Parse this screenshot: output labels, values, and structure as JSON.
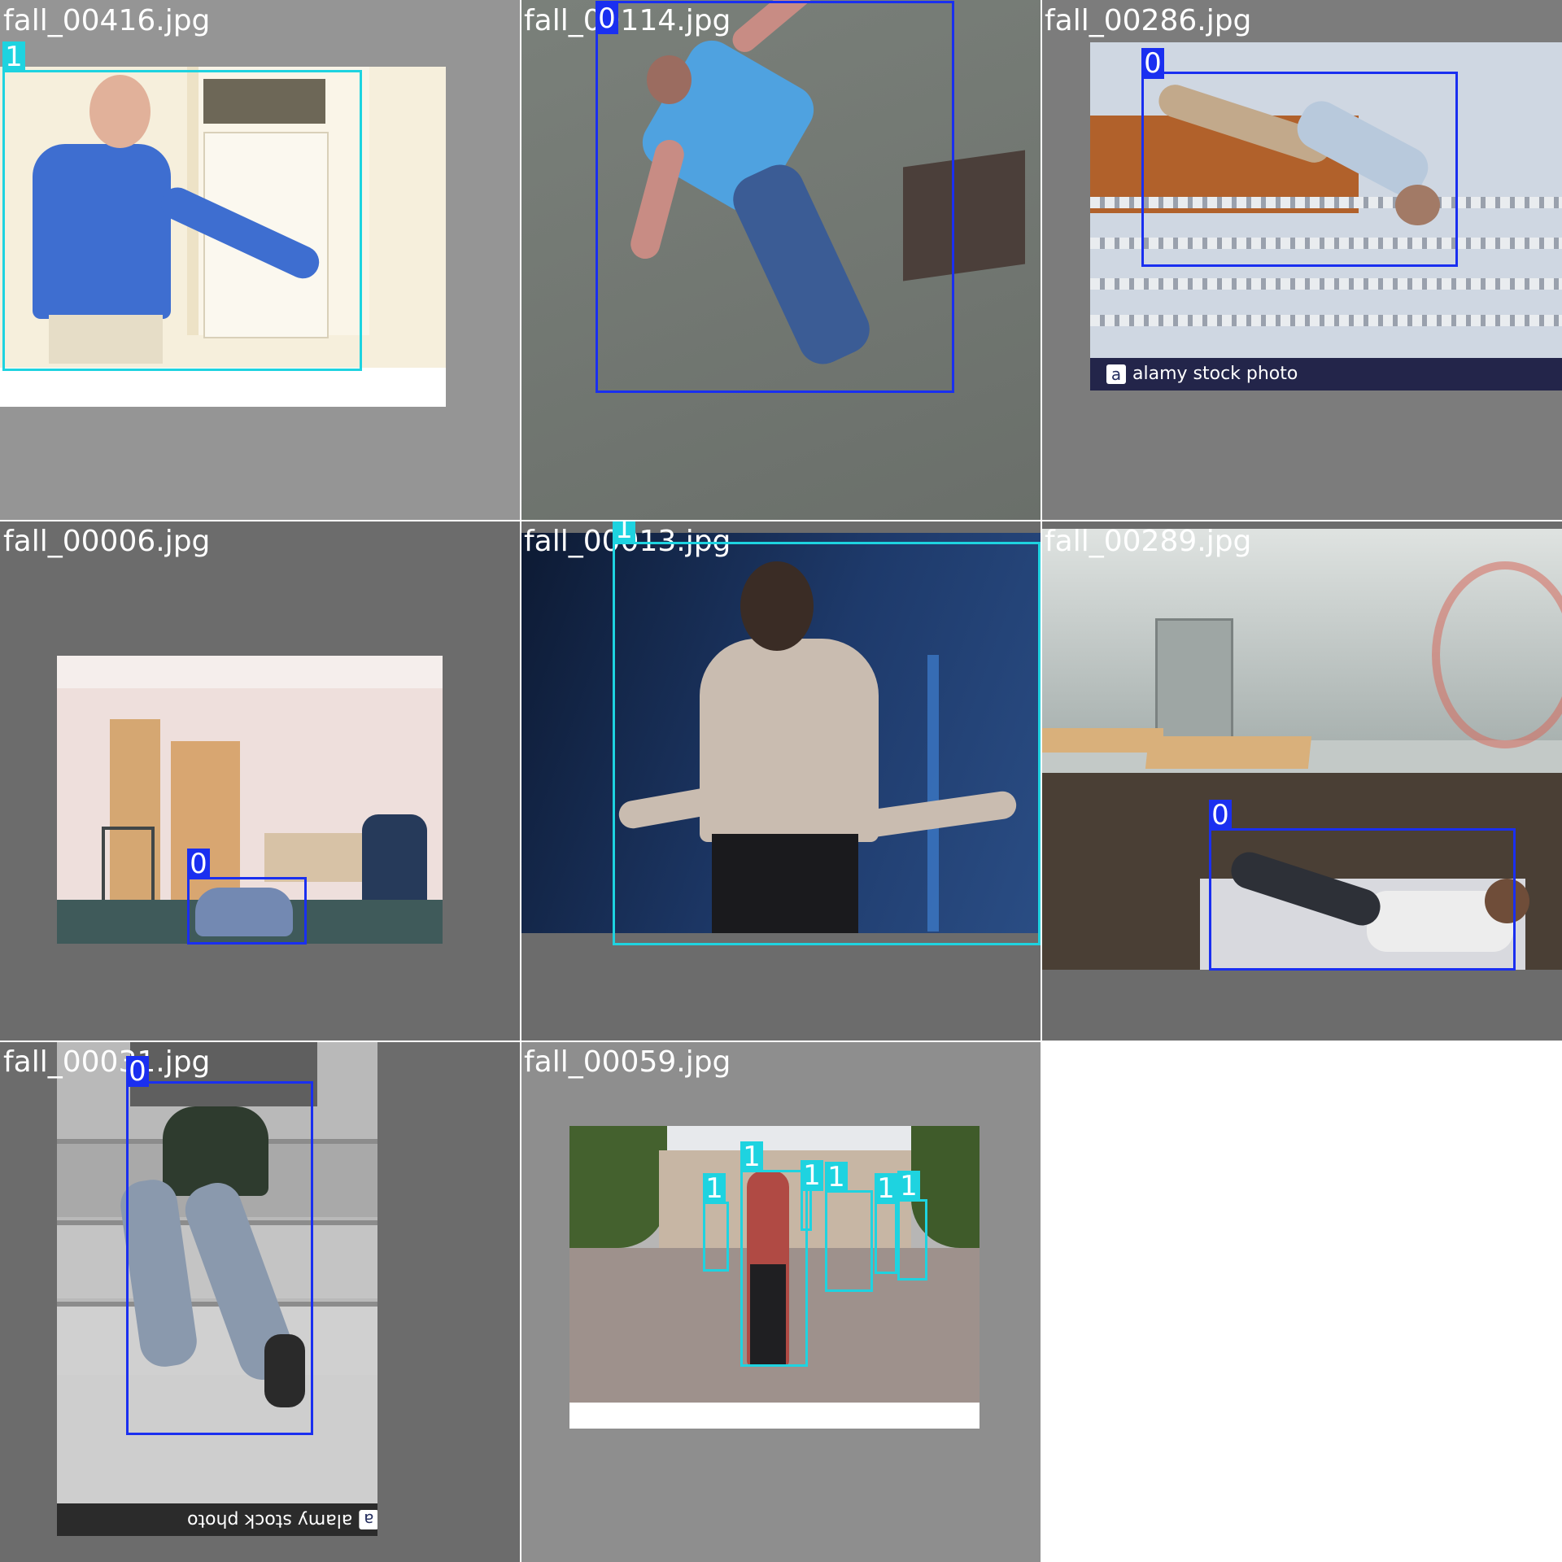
{
  "tiles": [
    {
      "filename": "fall_00416.jpg",
      "scene": "Elderly man in blue shirt smiling and gesturing in front of a white doorway",
      "boxes": [
        {
          "class": 1,
          "label": "1"
        }
      ]
    },
    {
      "filename": "fall_00114.jpg",
      "scene": "Overhead view of a man in a blue t-shirt and jeans lying on a grey floor",
      "boxes": [
        {
          "class": 0,
          "label": "0"
        }
      ]
    },
    {
      "filename": "fall_00286.jpg",
      "scene": "Man fallen on stairs",
      "watermark": "alamy stock photo",
      "boxes": [
        {
          "class": 0,
          "label": "0"
        }
      ]
    },
    {
      "filename": "fall_00006.jpg",
      "scene": "Office room with a person collapsed on the floor",
      "boxes": [
        {
          "class": 0,
          "label": "0"
        }
      ]
    },
    {
      "filename": "fall_00013.jpg",
      "scene": "Woman in white top standing with arms out against a dark blue background",
      "boxes": [
        {
          "class": 1,
          "label": "1"
        }
      ]
    },
    {
      "filename": "fall_00289.jpg",
      "scene": "Man lying on the floor of a lobby with glass walls",
      "boxes": [
        {
          "class": 0,
          "label": "0"
        }
      ]
    },
    {
      "filename": "fall_00031.jpg",
      "scene": "Man falling on outdoor stone steps",
      "watermark": "alamy stock photo",
      "boxes": [
        {
          "class": 0,
          "label": "0"
        }
      ]
    },
    {
      "filename": "fall_00059.jpg",
      "scene": "Bearded man standing with crossed arms in a busy pedestrian street",
      "boxes": [
        {
          "class": 1,
          "label": "1"
        },
        {
          "class": 1,
          "label": "1"
        },
        {
          "class": 1,
          "label": "1"
        },
        {
          "class": 1,
          "label": "1"
        },
        {
          "class": 1,
          "label": "1"
        },
        {
          "class": 1,
          "label": "1"
        }
      ]
    }
  ],
  "colors": {
    "class_0": "#1a2ff0",
    "class_1": "#1ed3e0",
    "tile_bg_light": "#8e8e8e",
    "tile_bg_dark": "#6c6c6c"
  }
}
